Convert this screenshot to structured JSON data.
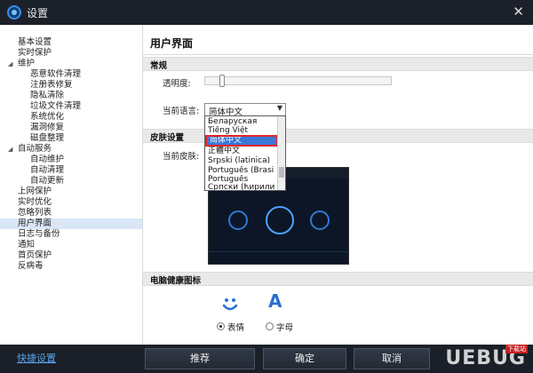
{
  "window": {
    "title": "设置"
  },
  "sidebar": {
    "items": [
      {
        "label": "基本设置"
      },
      {
        "label": "实时保护"
      },
      {
        "label": "维护"
      },
      {
        "label": "恶意软件清理"
      },
      {
        "label": "注册表修复"
      },
      {
        "label": "隐私清除"
      },
      {
        "label": "垃圾文件清理"
      },
      {
        "label": "系统优化"
      },
      {
        "label": "漏洞修复"
      },
      {
        "label": "磁盘整理"
      },
      {
        "label": "自动服务"
      },
      {
        "label": "自动维护"
      },
      {
        "label": "自动清理"
      },
      {
        "label": "自动更新"
      },
      {
        "label": "上网保护"
      },
      {
        "label": "实时优化"
      },
      {
        "label": "忽略列表"
      },
      {
        "label": "用户界面"
      },
      {
        "label": "日志与备份"
      },
      {
        "label": "通知"
      },
      {
        "label": "首页保护"
      },
      {
        "label": "反病毒"
      }
    ]
  },
  "main": {
    "title": "用户界面",
    "general": {
      "header": "常规",
      "opacity_label": "透明度:",
      "opacity_value": 0.08,
      "language_label": "当前语言:",
      "language_value": "简体中文",
      "language_options": [
        "Беларуская",
        "Tiếng Việt",
        "简体中文",
        "正體中文",
        "Srpski (latinica)",
        "Português (Brasil)",
        "Português",
        "Српски (ћирилиц"
      ]
    },
    "skin": {
      "header": "皮肤设置",
      "current_label": "当前皮肤:"
    },
    "health_icon": {
      "header": "电脑健康图标",
      "letter_glyph": "A",
      "options": [
        {
          "label": "表情",
          "selected": true
        },
        {
          "label": "字母",
          "selected": false
        }
      ]
    }
  },
  "footer": {
    "quick_settings": "快捷设置",
    "recommend": "推荐",
    "ok": "确定",
    "cancel": "取消"
  },
  "watermark": {
    "text": "UEBUG",
    "badge": "下载站"
  },
  "colors": {
    "accent": "#3a78d8",
    "highlight_border": "#e0262b",
    "titlebar": "#1c2029"
  }
}
